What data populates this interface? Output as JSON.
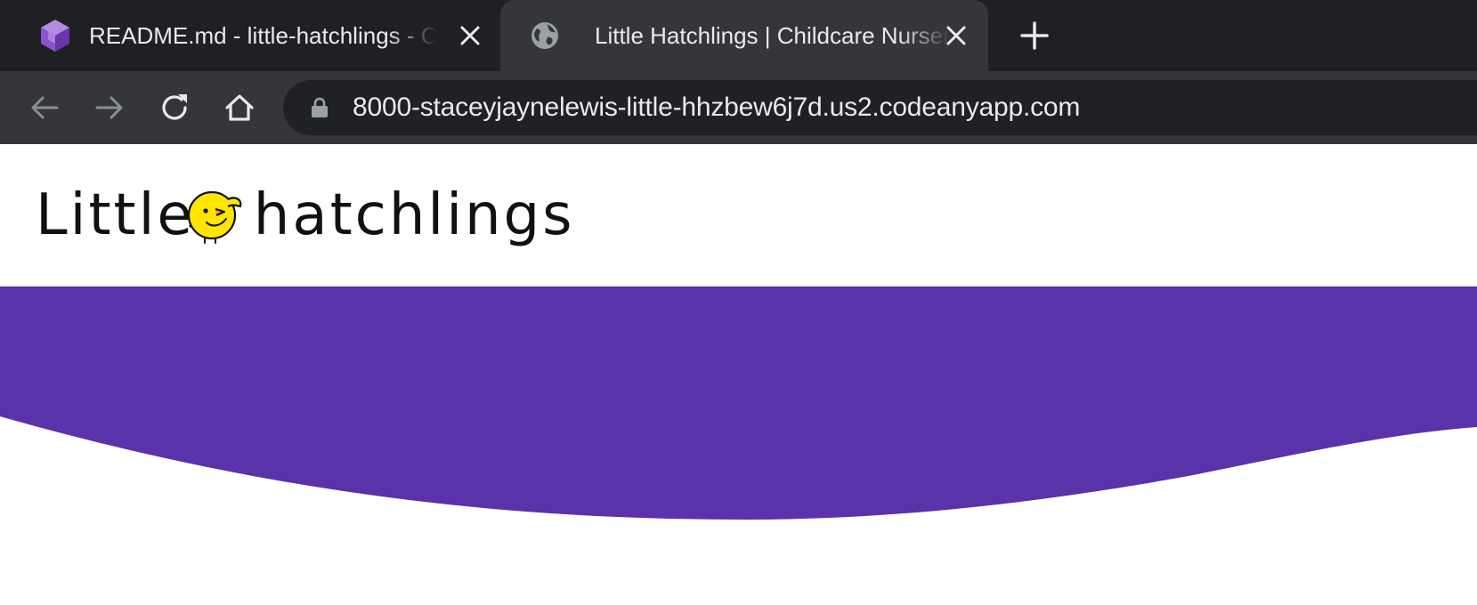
{
  "browser": {
    "tabs": [
      {
        "title": "README.md - little-hatchlings - Codeanywhere",
        "favicon": "codeanywhere-cube-icon",
        "active": false
      },
      {
        "title": "Little Hatchlings | Childcare Nursery",
        "favicon": "globe-icon",
        "active": true
      }
    ],
    "new_tab_icon": "plus-icon",
    "url": "8000-staceyjaynelewis-little-hhzbew6j7d.us2.codeanyapp.com"
  },
  "page": {
    "logo": {
      "left_word": "Little",
      "right_word": "hatchlings"
    },
    "hero_color": "#5a32aa"
  },
  "colors": {
    "tabstrip": "#1f2023",
    "toolbar": "#35363a",
    "omnibox": "#202124",
    "accent_purple": "#5a32aa",
    "chick_yellow": "#ffe600"
  }
}
